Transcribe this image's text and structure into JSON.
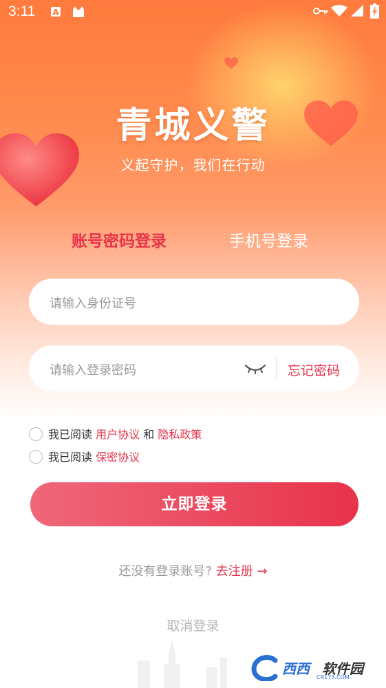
{
  "status_bar": {
    "time": "3:11",
    "icons": [
      "a-notification-icon",
      "cat-notification-icon",
      "key-icon",
      "wifi-icon",
      "signal-icon",
      "battery-icon"
    ]
  },
  "brand": {
    "title": "青城义警",
    "slogan": "义起守护，我们在行动"
  },
  "tabs": [
    {
      "label": "账号密码登录",
      "active": true
    },
    {
      "label": "手机号登录",
      "active": false
    }
  ],
  "form": {
    "id_number_placeholder": "请输入身份证号",
    "password_placeholder": "请输入登录密码",
    "forgot_password": "忘记密码"
  },
  "agreements": [
    {
      "prefix": "我已阅读 ",
      "link1": "用户协议",
      "middle": " 和 ",
      "link2": "隐私政策"
    },
    {
      "prefix": "我已阅读 ",
      "link1": "保密协议"
    }
  ],
  "login_button": "立即登录",
  "register": {
    "prompt": "还没有登录账号?",
    "link": "去注册",
    "arrow": "→"
  },
  "cancel_login": "取消登录",
  "watermark": {
    "brand_blue": "西西",
    "brand_dark": "软件园",
    "site": "CR173.COM"
  },
  "colors": {
    "accent": "#e8334a",
    "header_top": "#ff7a3d",
    "placeholder": "#9a9a9a"
  }
}
